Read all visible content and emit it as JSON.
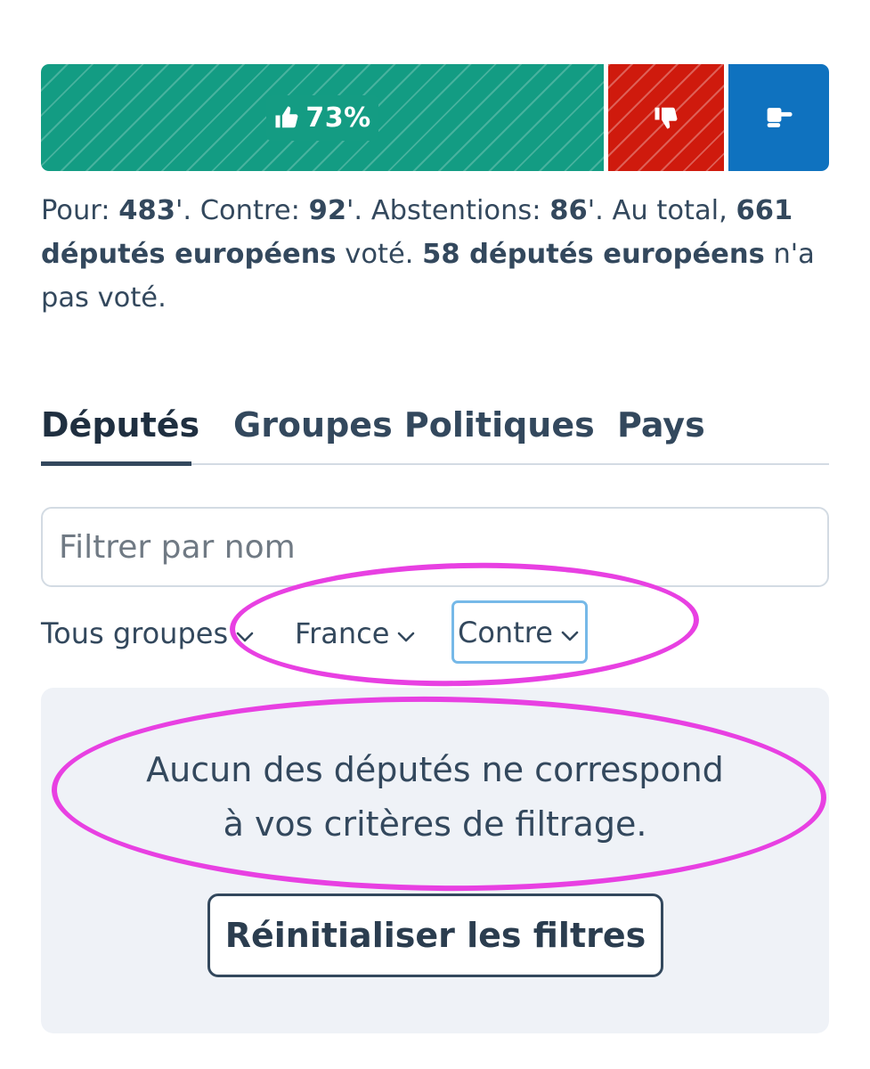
{
  "vote_bar": {
    "for_percent_label": "73%",
    "for_fraction": 0.73,
    "against_fraction": 0.15,
    "abstain_fraction": 0.13,
    "colors": {
      "for": "#139c83",
      "against": "#cf1a0d",
      "abstain": "#0f72bf"
    },
    "icons": {
      "for": "thumbs-up-icon",
      "against": "thumbs-down-icon",
      "abstain": "hand-abstain-icon"
    }
  },
  "summary": {
    "for_label": "Pour: ",
    "for_value": "483",
    "sep1": "'. Contre: ",
    "against_value": "92",
    "sep2": "'. Abstentions: ",
    "abstain_value": "86",
    "sep3": "'. Au total, ",
    "total_value": "661 députés européens",
    "voted_text": " voté. ",
    "absent_value": "58 députés européens",
    "absent_text": " n'a pas voté."
  },
  "tabs": [
    {
      "label": "Députés",
      "active": true
    },
    {
      "label": "Groupes Politiques",
      "active": false
    },
    {
      "label": "Pays",
      "active": false
    }
  ],
  "filter": {
    "placeholder": "Filtrer par nom",
    "value": ""
  },
  "selects": {
    "group": "Tous groupes",
    "country": "France",
    "position": "Contre"
  },
  "empty_state": {
    "line1": "Aucun des députés ne correspond",
    "line2": "à vos critères de filtrage.",
    "reset_label": "Réinitialiser les filtres"
  },
  "annotation_color": "#e840e2"
}
